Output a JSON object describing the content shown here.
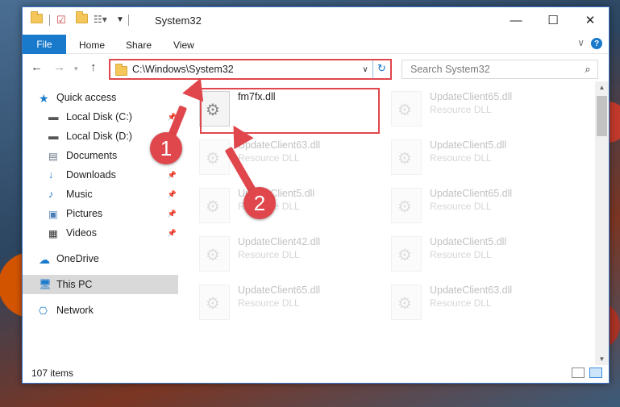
{
  "window": {
    "title": "System32",
    "controls": {
      "minimize": "—",
      "maximize": "☐",
      "close": "✕"
    }
  },
  "ribbon": {
    "file": "File",
    "tabs": [
      "Home",
      "Share",
      "View"
    ],
    "help": "?"
  },
  "nav": {
    "address": "C:\\Windows\\System32",
    "search_placeholder": "Search System32"
  },
  "sidebar": {
    "items": [
      {
        "label": "Quick access",
        "icon": "star-icon",
        "pinned": false
      },
      {
        "label": "Local Disk (C:)",
        "icon": "drive-icon",
        "pinned": true
      },
      {
        "label": "Local Disk (D:)",
        "icon": "drive-icon",
        "pinned": false
      },
      {
        "label": "Documents",
        "icon": "documents-icon",
        "pinned": true
      },
      {
        "label": "Downloads",
        "icon": "download-icon",
        "pinned": true
      },
      {
        "label": "Music",
        "icon": "music-icon",
        "pinned": true
      },
      {
        "label": "Pictures",
        "icon": "pictures-icon",
        "pinned": true
      },
      {
        "label": "Videos",
        "icon": "videos-icon",
        "pinned": true
      },
      {
        "label": "OneDrive",
        "icon": "cloud-icon",
        "pinned": false
      },
      {
        "label": "This PC",
        "icon": "pc-icon",
        "pinned": false,
        "active": true
      },
      {
        "label": "Network",
        "icon": "network-icon",
        "pinned": false
      }
    ]
  },
  "files": [
    {
      "name": "fm7fx.dll",
      "type": ""
    },
    {
      "name": "UpdateClient65.dll",
      "type": "Resource DLL"
    },
    {
      "name": "UpdateClient63.dll",
      "type": "Resource DLL"
    },
    {
      "name": "UpdateClient5.dll",
      "type": "Resource DLL"
    },
    {
      "name": "UpdateClient5.dll",
      "type": "Resource DLL"
    },
    {
      "name": "UpdateClient65.dll",
      "type": "Resource DLL"
    },
    {
      "name": "UpdateClient42.dll",
      "type": "Resource DLL"
    },
    {
      "name": "UpdateClient5.dll",
      "type": "Resource DLL"
    },
    {
      "name": "UpdateClient65.dll",
      "type": "Resource DLL"
    },
    {
      "name": "UpdateClient63.dll",
      "type": "Resource DLL"
    }
  ],
  "status": {
    "item_count": "107 items"
  },
  "annotations": {
    "step1": "1",
    "step2": "2",
    "color": "#e0474c"
  }
}
